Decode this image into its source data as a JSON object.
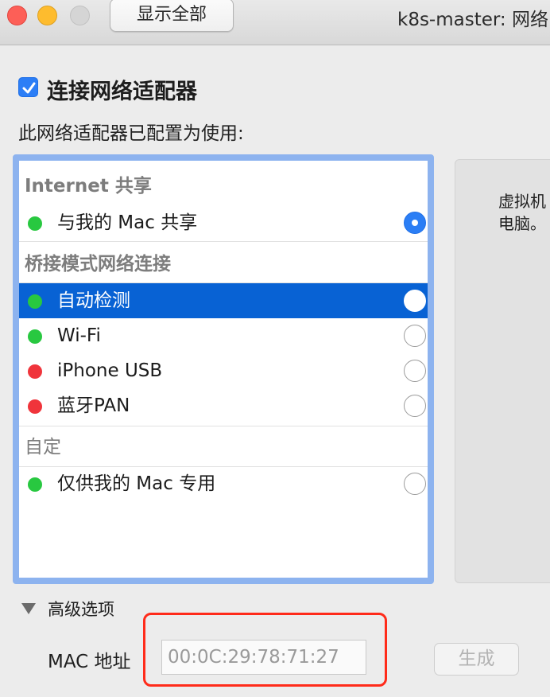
{
  "window": {
    "title": "k8s-master: 网络",
    "show_all_label": "显示全部"
  },
  "connect": {
    "label": "连接网络适配器",
    "checked": true
  },
  "configured_label": "此网络适配器已配置为使用:",
  "list": {
    "sections": [
      {
        "header": "Internet 共享",
        "items": [
          {
            "label": "与我的 Mac 共享",
            "status_color": "#28c840",
            "selected_radio": true,
            "highlighted": false
          }
        ]
      },
      {
        "header": "桥接模式网络连接",
        "items": [
          {
            "label": "自动检测",
            "status_color": "#28c840",
            "selected_radio": false,
            "highlighted": true
          },
          {
            "label": "Wi-Fi",
            "status_color": "#28c840",
            "selected_radio": false,
            "highlighted": false
          },
          {
            "label": "iPhone USB",
            "status_color": "#f0343b",
            "selected_radio": false,
            "highlighted": false
          },
          {
            "label": "蓝牙PAN",
            "status_color": "#f0343b",
            "selected_radio": false,
            "highlighted": false
          }
        ]
      },
      {
        "header": "自定",
        "items": [
          {
            "label": "仅供我的 Mac 专用",
            "status_color": "#28c840",
            "selected_radio": false,
            "highlighted": false
          }
        ]
      }
    ]
  },
  "side_panel": {
    "line1": "虚拟机",
    "line2": "电脑。"
  },
  "advanced": {
    "label": "高级选项",
    "mac_label": "MAC 地址",
    "mac_value": "00:0C:29:78:71:27",
    "generate_label": "生成"
  },
  "colors": {
    "accent": "#0862d4",
    "highlight_border": "#ff2b1a"
  }
}
